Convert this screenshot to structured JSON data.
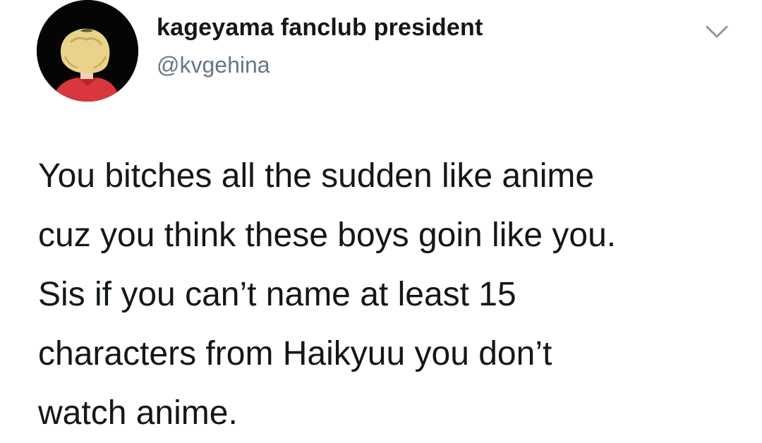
{
  "author": {
    "display_name": "kageyama fanclub president",
    "handle": "@kvgehina",
    "avatar": "avatar-anime-character-blond-hair-red-jacket"
  },
  "menu": {
    "icon": "chevron-down-icon"
  },
  "tweet": {
    "text": "You bitches all the sudden like anime\ncuz you think these boys goin like you.\nSis if you can’t name at least 15\ncharacters from Haikyuu you don’t\nwatch anime."
  },
  "colors": {
    "text": "#14171a",
    "secondary": "#657786",
    "caret": "#8899a6",
    "avatar_bg": "#050505",
    "hair": "#e9d28a",
    "jacket": "#d9363e"
  }
}
